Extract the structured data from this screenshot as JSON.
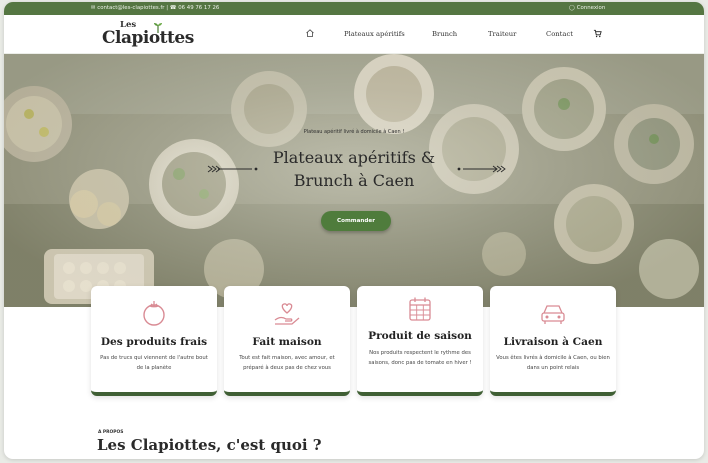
{
  "topbar": {
    "contact": "✉ contact@les-clapiottes.fr | ☎ 06 49 76 17 26",
    "login": "◯ Connexion"
  },
  "logo": {
    "line1": "Les",
    "line2": "Clapiottes"
  },
  "nav": {
    "items": [
      {
        "label": "Plateaux apéritifs"
      },
      {
        "label": "Brunch"
      },
      {
        "label": "Traiteur"
      },
      {
        "label": "Contact"
      }
    ]
  },
  "hero": {
    "kicker": "Plateau apéritif livré à domicile à Caen !",
    "title_line1": "Plateaux apéritifs &",
    "title_line2": "Brunch à Caen",
    "cta": "Commander"
  },
  "features": [
    {
      "icon": "tomato-icon",
      "title": "Des produits frais",
      "desc": "Pas de trucs qui viennent de l'autre bout de la planète"
    },
    {
      "icon": "heart-hand-icon",
      "title": "Fait maison",
      "desc": "Tout est fait maison, avec amour, et préparé à deux pas de chez vous"
    },
    {
      "icon": "calendar-icon",
      "title": "Produit de saison",
      "desc": "Nos produits respectent le rythme des saisons, donc pas de tomate en hiver !"
    },
    {
      "icon": "car-icon",
      "title": "Livraison à Caen",
      "desc": "Vous êtes livrés à domicile à Caen, ou bien dans un point relais"
    }
  ],
  "about": {
    "kicker": "A PROPOS",
    "title": "Les Clapiottes, c'est quoi ?"
  },
  "colors": {
    "brand_green": "#557642",
    "accent_pink": "#d98b94",
    "button_green": "#4f7c3c"
  }
}
